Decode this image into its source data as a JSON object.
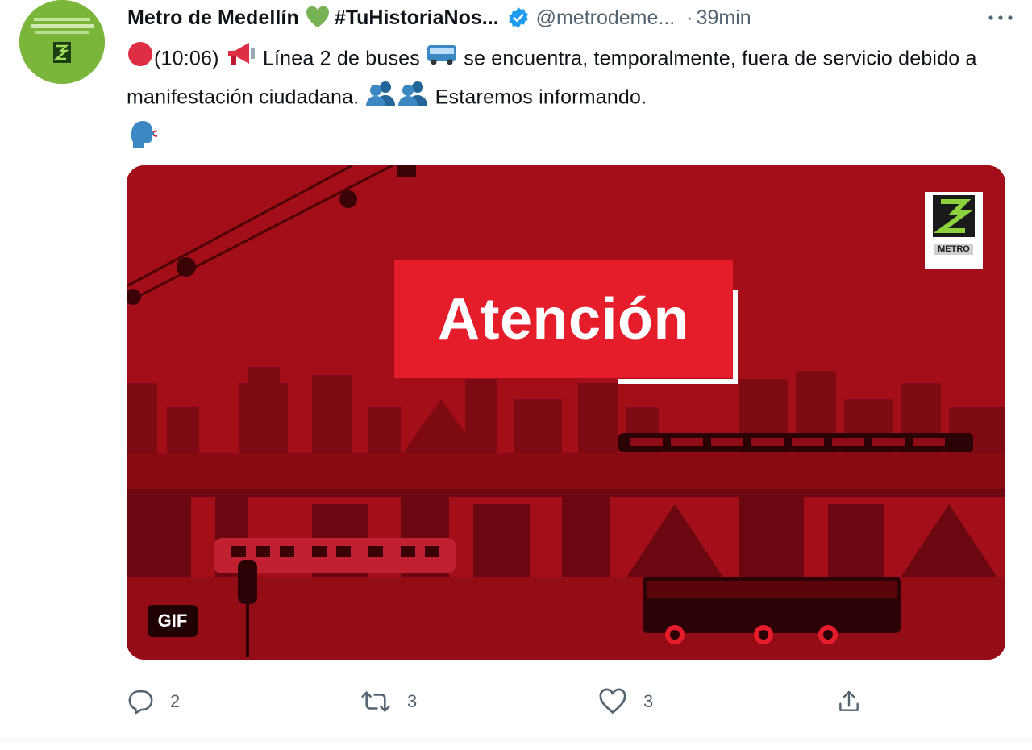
{
  "tweet": {
    "display_name": "Metro de Medellín",
    "hashtag_name": "#TuHistoriaNos...",
    "handle": "@metrodeme...",
    "separator": "·",
    "time": "39min",
    "more_label": "···",
    "text": {
      "time_prefix": "(10:06)",
      "line_a": "Línea 2 de buses",
      "line_b": "se encuentra, temporalmente, fuera de servicio debido a manifestación ciudadana.",
      "line_c": "Estaremos informando."
    },
    "media": {
      "headline": "Atención",
      "badge": "GIF",
      "logo_text": "METRO"
    },
    "actions": {
      "replies": "2",
      "retweets": "3",
      "likes": "3"
    }
  },
  "colors": {
    "accent_blue": "#1d9bf0",
    "banner_red": "#a50d17",
    "headline_red": "#e51d2b",
    "avatar_green": "#7ab63a",
    "muted": "#536471"
  },
  "icons": [
    "heart-icon",
    "verified-icon",
    "red-circle-icon",
    "megaphone-icon",
    "bus-icon",
    "people-icon",
    "speaking-head-icon",
    "reply-icon",
    "retweet-icon",
    "like-icon",
    "share-icon",
    "more-icon"
  ]
}
